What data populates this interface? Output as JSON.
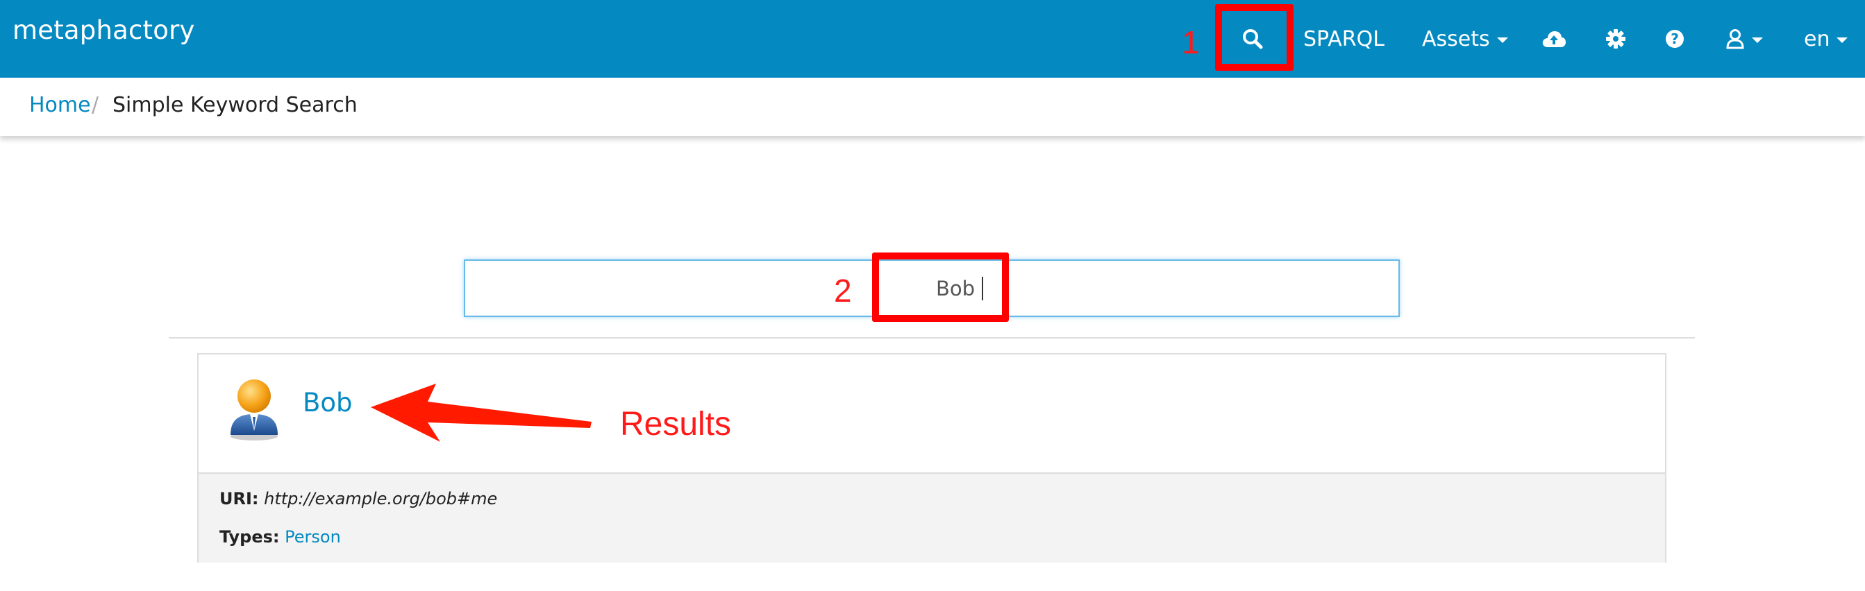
{
  "navbar": {
    "brand": "metaphactory",
    "search_icon": "search-icon",
    "sparql_label": "SPARQL",
    "assets_label": "Assets",
    "upload_icon": "cloud-upload-icon",
    "settings_icon": "gear-icon",
    "help_icon": "help-icon",
    "user_icon": "user-icon",
    "language_label": "en",
    "background_color": "#0489c1"
  },
  "breadcrumb": {
    "home": "Home",
    "separator": "/",
    "current": "Simple Keyword Search"
  },
  "search": {
    "value": "Bob",
    "placeholder": ""
  },
  "results": [
    {
      "title": "Bob",
      "icon": "person-avatar-icon",
      "uri_label": "URI:",
      "uri": "http://example.org/bob#me",
      "types_label": "Types:",
      "type": "Person"
    }
  ],
  "annotations": {
    "step1": "1",
    "step2": "2",
    "results_label": "Results",
    "color": "#ff0000"
  }
}
